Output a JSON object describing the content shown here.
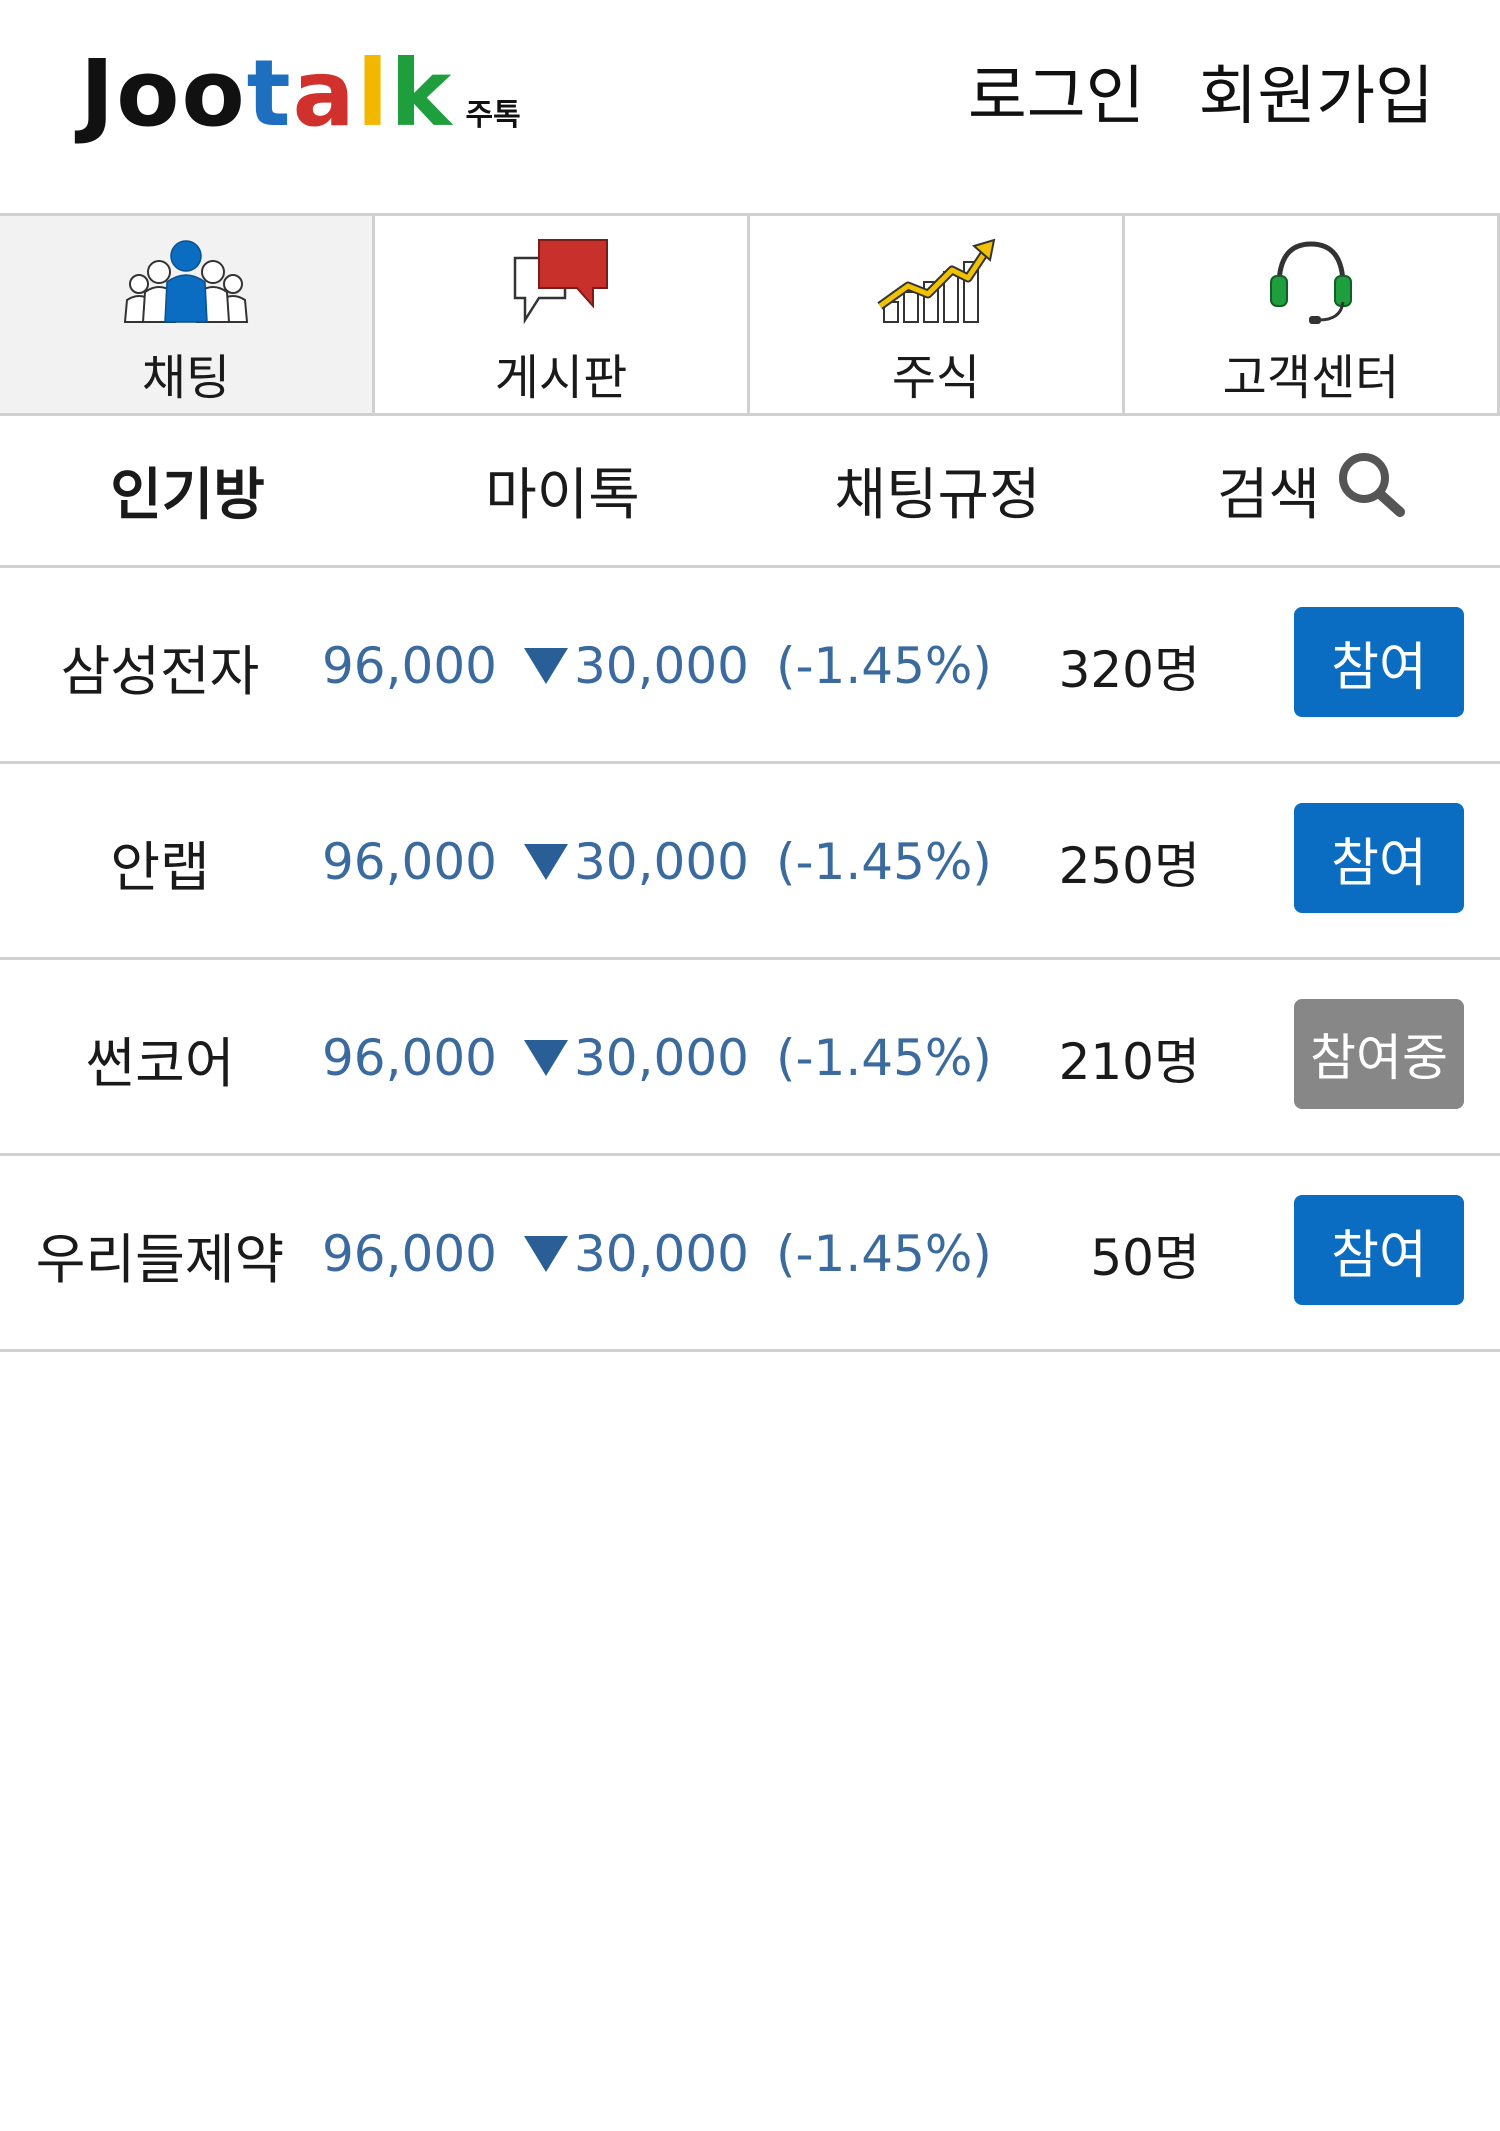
{
  "header": {
    "logo": {
      "letters": [
        {
          "ch": "J",
          "color": "#111111"
        },
        {
          "ch": "o",
          "color": "#111111"
        },
        {
          "ch": "o",
          "color": "#111111"
        },
        {
          "ch": "t",
          "color": "#1f6fc0"
        },
        {
          "ch": "a",
          "color": "#d0312d"
        },
        {
          "ch": "l",
          "color": "#f2b800"
        },
        {
          "ch": "k",
          "color": "#1f9e3e"
        }
      ],
      "sub": "주톡"
    },
    "login": "로그인",
    "signup": "회원가입"
  },
  "categories": [
    {
      "label": "채팅",
      "icon": "people-icon",
      "active": true
    },
    {
      "label": "게시판",
      "icon": "speech-bubbles-icon",
      "active": false
    },
    {
      "label": "주식",
      "icon": "chart-up-icon",
      "active": false
    },
    {
      "label": "고객센터",
      "icon": "headset-icon",
      "active": false
    }
  ],
  "subtabs": [
    {
      "label": "인기방",
      "active": true
    },
    {
      "label": "마이톡",
      "active": false
    },
    {
      "label": "채팅규정",
      "active": false
    },
    {
      "label": "검색",
      "active": false,
      "icon": "search-icon"
    }
  ],
  "rooms": [
    {
      "name": "삼성전자",
      "price": "96,000",
      "change": "30,000",
      "percent": "(-1.45%)",
      "count": "320명",
      "action": "참여",
      "joined": false
    },
    {
      "name": "안랩",
      "price": "96,000",
      "change": "30,000",
      "percent": "(-1.45%)",
      "count": "250명",
      "action": "참여",
      "joined": false
    },
    {
      "name": "썬코어",
      "price": "96,000",
      "change": "30,000",
      "percent": "(-1.45%)",
      "count": "210명",
      "action": "참여중",
      "joined": true
    },
    {
      "name": "우리들제약",
      "price": "96,000",
      "change": "30,000",
      "percent": "(-1.45%)",
      "count": "50명",
      "action": "참여",
      "joined": false
    }
  ],
  "colors": {
    "accent": "#0a6dc2",
    "joined": "#878787",
    "price": "#3b6a9e"
  }
}
